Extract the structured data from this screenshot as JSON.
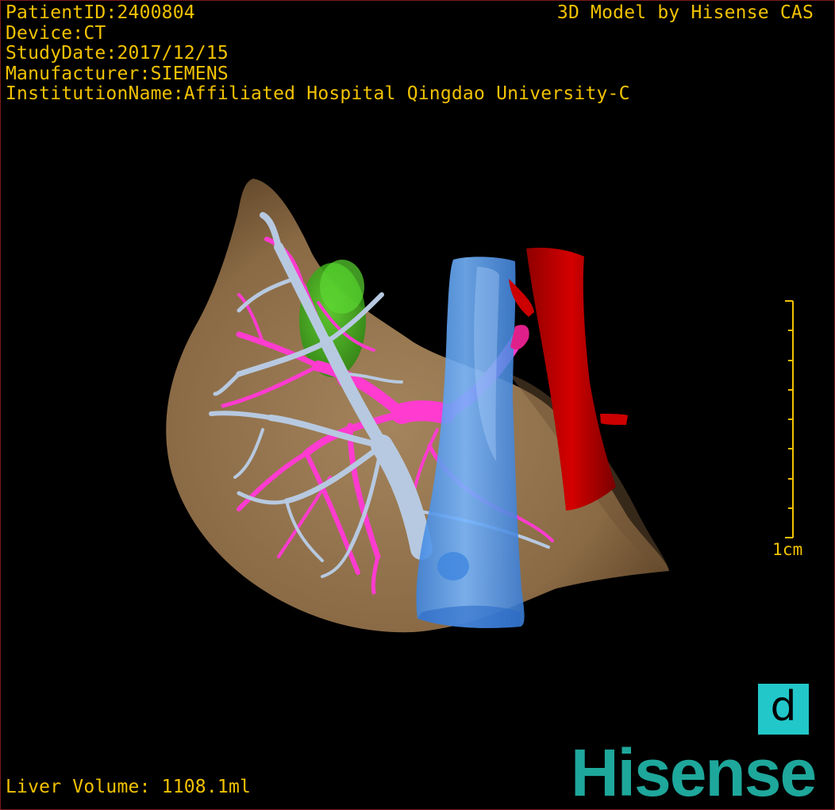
{
  "header": {
    "patient_id": "PatientID:2400804",
    "device": "Device:CT",
    "study_date": "StudyDate:2017/12/15",
    "manufacturer": "Manufacturer:SIEMENS",
    "institution": "InstitutionName:Affiliated Hospital Qingdao University-C"
  },
  "credit": "3D Model by Hisense CAS",
  "footer": {
    "liver_volume": "Liver Volume: 1108.1ml"
  },
  "scale": {
    "label": "1cm"
  },
  "badge": {
    "letter": "d"
  },
  "brand": {
    "name": "Hisense"
  },
  "colors": {
    "text": "#f2c200",
    "liver": "#8a6a45",
    "portal_vein": "#b7c9e0",
    "hepatic_vein": "#ff3bd0",
    "vena_cava": "#5aa4f5",
    "aorta": "#cc0000",
    "lesion": "#3fb81a",
    "brand": "#1ea79b",
    "badge": "#22c7c9"
  },
  "icons": {
    "badge": "letter-d-badge"
  }
}
